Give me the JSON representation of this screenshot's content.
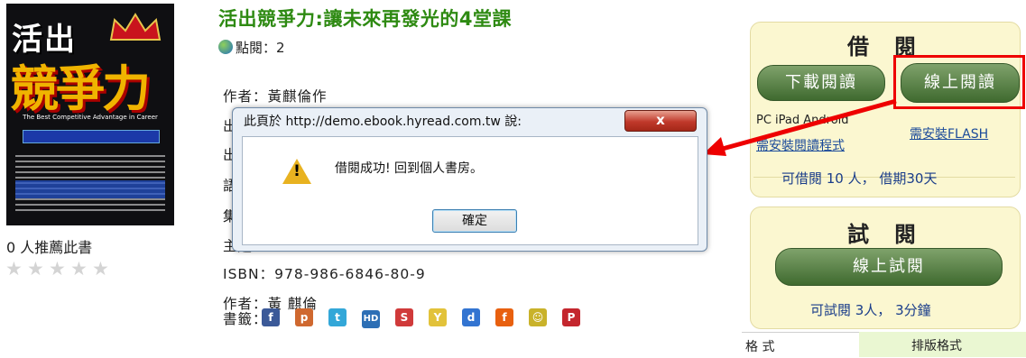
{
  "cover": {
    "title_line1": "活出",
    "title_line2": "競爭力",
    "subtitle": "The Best Competitive Advantage in Career",
    "alt": "book-cover"
  },
  "recommend_text": "0 人推薦此書",
  "rating": {
    "stars": 0,
    "max": 5
  },
  "book": {
    "title": "活出競爭力:讓未來再發光的4堂課",
    "views_label": "點閱：2",
    "author_label": "作者：黃麒倫作",
    "publisher_partial": "出版",
    "pubdate_partial": "出版",
    "language_partial": "語文",
    "series_partial": "集叢",
    "subject_partial": "主題",
    "isbn_label": "ISBN：978-986-6846-80-9",
    "author2_label": "作者：黃 麒倫",
    "bookmark_label": "書籤："
  },
  "bookmarks": [
    {
      "name": "facebook-icon",
      "glyph": "f",
      "color": "#3b5998"
    },
    {
      "name": "plurk-icon",
      "glyph": "p",
      "color": "#cf682f"
    },
    {
      "name": "twitter-icon",
      "glyph": "t",
      "color": "#33a7d8"
    },
    {
      "name": "hemidemi-icon",
      "glyph": "HD",
      "color": "#2d6fb5"
    },
    {
      "name": "funp-icon",
      "glyph": "S",
      "color": "#d03a3a"
    },
    {
      "name": "yahoo-icon",
      "glyph": "Y",
      "color": "#e2c23a"
    },
    {
      "name": "delicious-icon",
      "glyph": "d",
      "color": "#3274d1"
    },
    {
      "name": "funp2-icon",
      "glyph": "f",
      "color": "#e8600f"
    },
    {
      "name": "udn-icon",
      "glyph": "☺",
      "color": "#c9b22a"
    },
    {
      "name": "pixnet-icon",
      "glyph": "P",
      "color": "#c4262e"
    }
  ],
  "borrow": {
    "heading": "借閱",
    "download_btn": "下載閱讀",
    "online_btn": "線上閱讀",
    "platforms": "PC iPad Android",
    "install_reader": "需安裝閱讀程式",
    "install_flash": "需安裝FLASH",
    "availability": "可借閱 10 人， 借期30天"
  },
  "trial": {
    "heading": "試閱",
    "online_btn": "線上試閱",
    "availability": "可試閱 3人， 3分鐘"
  },
  "format_table": {
    "label": "格 式",
    "value": "排版格式"
  },
  "dialog": {
    "title": "此頁於 http://demo.ebook.hyread.com.tw 說:",
    "close": "x",
    "message": "借閱成功! 回到個人書房。",
    "ok": "確定"
  },
  "colors": {
    "title_green": "#2e8a12",
    "accent_red": "#e00000",
    "panel_bg": "#fbf7d0"
  }
}
